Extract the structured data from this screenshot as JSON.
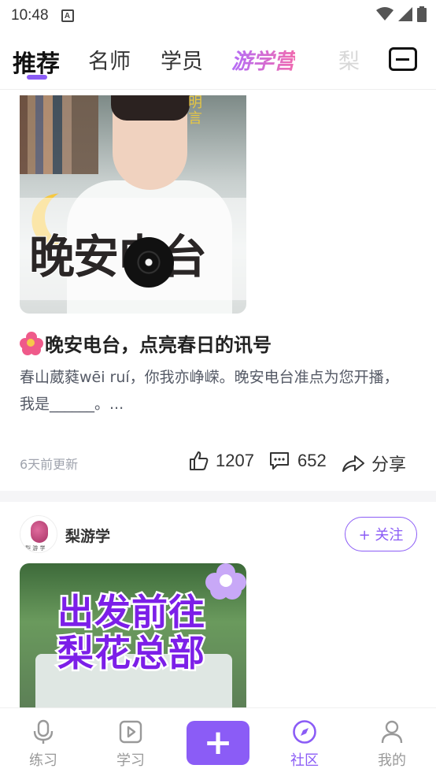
{
  "status_bar": {
    "time": "10:48",
    "notification_glyph": "A"
  },
  "top_tabs": {
    "items": [
      {
        "label": "推荐",
        "active": true
      },
      {
        "label": "名师"
      },
      {
        "label": "学员"
      },
      {
        "label": "游学营",
        "style": "gradient"
      },
      {
        "label": "梨"
      }
    ],
    "mail_icon": "mail-icon"
  },
  "post1": {
    "thumbnail": {
      "title": "晚安电台",
      "vertical_text": "明言"
    },
    "title": "晚安电台，点亮春日的讯号",
    "body": "春山葳蕤wēi ruí，你我亦峥嵘。晚安电台准点为您开播，我是______。...",
    "updated": "6天前更新",
    "likes": "1207",
    "comments": "652",
    "share_label": "分享"
  },
  "post2": {
    "author": "梨游学",
    "avatar_text": "梨 游 学",
    "follow_label": "+ 关注",
    "thumbnail": {
      "line1": "出发前往",
      "line2": "梨花总部"
    }
  },
  "bottom_nav": {
    "items": [
      {
        "label": "练习",
        "icon": "microphone-icon"
      },
      {
        "label": "学习",
        "icon": "play-icon"
      },
      {
        "label": "社区",
        "icon": "compass-icon",
        "active": true
      },
      {
        "label": "我的",
        "icon": "user-icon"
      }
    ],
    "plus": "+"
  },
  "colors": {
    "accent": "#8b5cf6",
    "divider": "#f5f5f7"
  }
}
